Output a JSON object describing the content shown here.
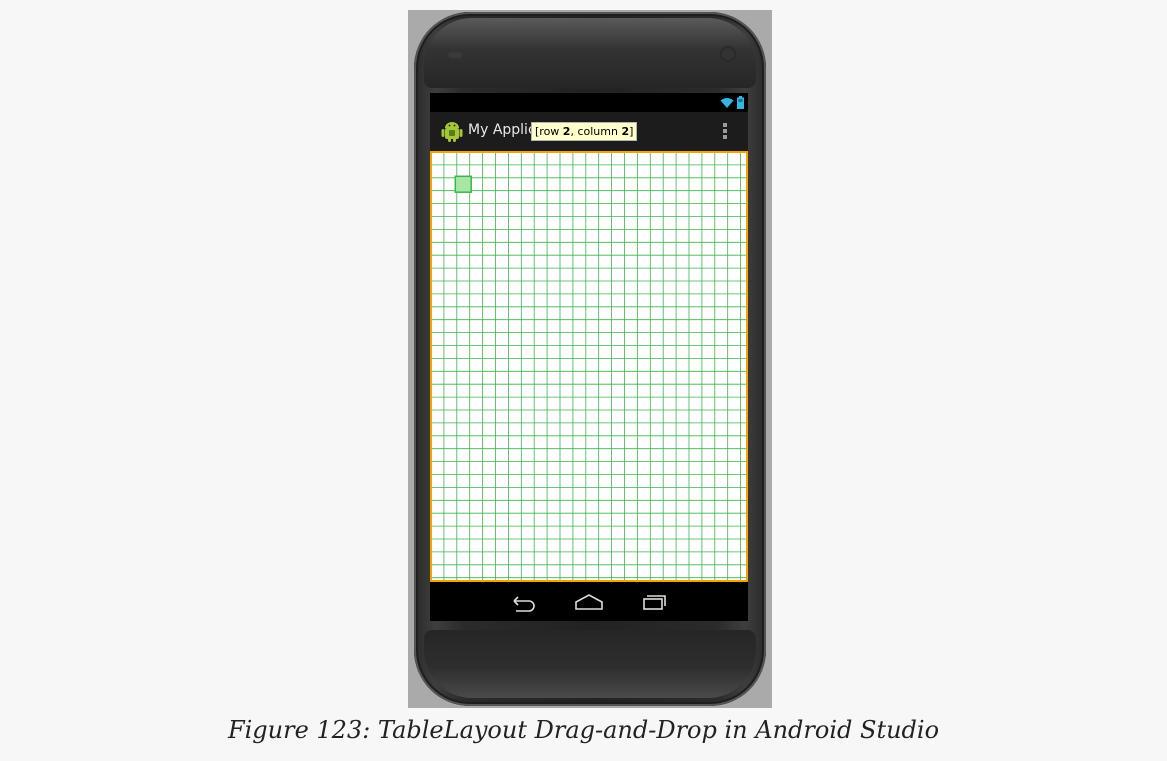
{
  "action_bar": {
    "app_title": "My Applic",
    "tooltip": {
      "prefix": "[row ",
      "row": "2",
      "middle": ", column ",
      "column": "2",
      "suffix": "]"
    }
  },
  "status_bar": {
    "icons": [
      "wifi-icon",
      "battery-icon"
    ]
  },
  "nav_bar": {
    "icons": [
      "back-icon",
      "home-icon",
      "recent-apps-icon"
    ]
  },
  "table_layout": {
    "highlighted_cell": {
      "row": 2,
      "column": 2
    }
  },
  "caption": "Figure 123: TableLayout Drag-and-Drop in Android Studio",
  "colors": {
    "grid_line": "#3cb44b",
    "selection_border": "#f4a300",
    "highlight_fill": "#a8e6a8",
    "tooltip_bg": "#ffffcc"
  }
}
